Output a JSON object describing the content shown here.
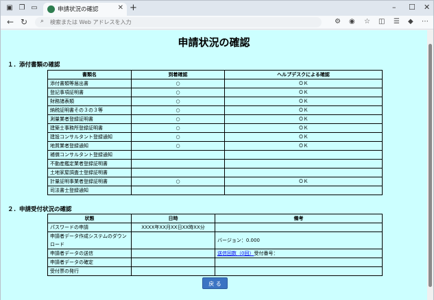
{
  "browser": {
    "tab_title": "申請状況の確認",
    "address_placeholder": "検索または Web アドレスを入力"
  },
  "page": {
    "title": "申請状況の確認",
    "section1_title": "１．添付書類の確認",
    "section2_title": "２．申請受付状況の確認",
    "back_button": "戻 る"
  },
  "docs_table": {
    "headers": [
      "書類名",
      "到着確認",
      "ヘルプデスクによる確認"
    ],
    "rows": [
      {
        "name": "添付書類等届出書",
        "arrival": "○",
        "help": "ＯＫ"
      },
      {
        "name": "登記事項証明書",
        "arrival": "○",
        "help": "ＯＫ"
      },
      {
        "name": "財務諸表類",
        "arrival": "○",
        "help": "ＯＫ"
      },
      {
        "name": "納税証明書その３の３等",
        "arrival": "○",
        "help": "ＯＫ"
      },
      {
        "name": "測量業者登録証明書",
        "arrival": "○",
        "help": "ＯＫ"
      },
      {
        "name": "建築士事務所登録証明書",
        "arrival": "○",
        "help": "ＯＫ"
      },
      {
        "name": "建設コンサルタント登録通知",
        "arrival": "○",
        "help": "ＯＫ"
      },
      {
        "name": "地質業者登録通知",
        "arrival": "○",
        "help": "ＯＫ"
      },
      {
        "name": "補償コンサルタント登録通知",
        "arrival": "",
        "help": ""
      },
      {
        "name": "不動産鑑定業者登録証明書",
        "arrival": "",
        "help": ""
      },
      {
        "name": "土地家屋調査士登録証明書",
        "arrival": "",
        "help": ""
      },
      {
        "name": "計量証明事業者登録証明書",
        "arrival": "○",
        "help": "ＯＫ"
      },
      {
        "name": "司法書士登録通知",
        "arrival": "",
        "help": ""
      }
    ]
  },
  "status_table": {
    "headers": [
      "状態",
      "日時",
      "備考"
    ],
    "rows": [
      {
        "state": "パスワードの申請",
        "datetime": "XXXX年XX月XX日XX時XX分",
        "note": ""
      },
      {
        "state": "申請者データ作成システムのダウンロード",
        "datetime": "",
        "note": "バージョン：0.000"
      },
      {
        "state": "申請者データの送信",
        "datetime": "",
        "note_link": "送信回数（0回）",
        "note_after": "受付番号："
      },
      {
        "state": "申請者データの確定",
        "datetime": "",
        "note": ""
      },
      {
        "state": "受付票の発行",
        "datetime": "",
        "note": ""
      }
    ]
  }
}
